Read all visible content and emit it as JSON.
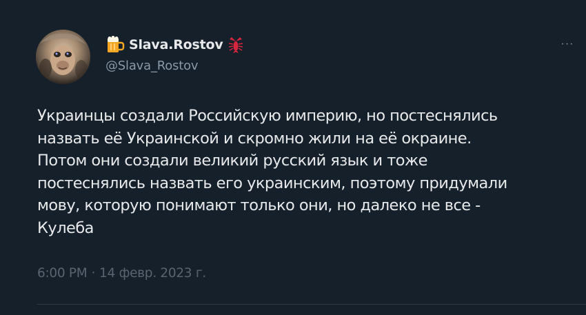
{
  "tweet": {
    "author": {
      "display_name": "Slava.Rostov",
      "handle": "@Slava_Rostov",
      "name_prefix_icon": "beer-mug-icon",
      "name_suffix_icon": "lobster-icon"
    },
    "more_label": "···",
    "text": "Украинцы создали Российскую империю, но постеснялись\nназвать её Украинской и скромно жили на её окраине.\nПотом они создали великий русский язык и тоже\nпостеснялись назвать его украинским, поэтому придумали\nмову, которую понимают только они, но далеко не все -\nКулеба",
    "time": "6:00 PM",
    "separator": "·",
    "date": "14 февр. 2023 г."
  },
  "colors": {
    "background": "#15202b",
    "text": "#e7e9ea",
    "secondary": "#8b98a5",
    "timestamp": "#5a6470"
  }
}
